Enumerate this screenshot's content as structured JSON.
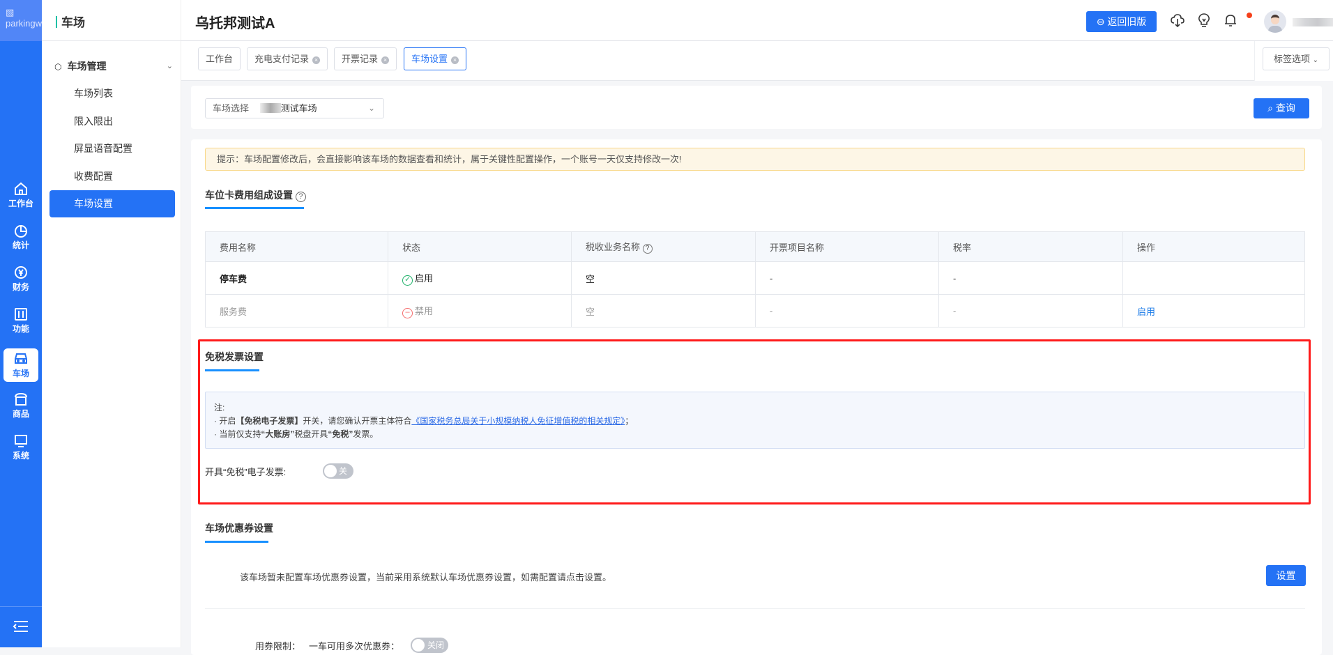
{
  "logo": {
    "alt": "parkingw"
  },
  "iconbar": {
    "items": [
      {
        "label": "工作台",
        "icon": "home-icon"
      },
      {
        "label": "统计",
        "icon": "pie-chart-icon"
      },
      {
        "label": "财务",
        "icon": "yen-icon"
      },
      {
        "label": "功能",
        "icon": "sliders-icon"
      },
      {
        "label": "车场",
        "icon": "car-icon",
        "active": true
      },
      {
        "label": "商品",
        "icon": "store-icon"
      },
      {
        "label": "系统",
        "icon": "monitor-icon"
      }
    ]
  },
  "sidebar": {
    "title": "车场",
    "group": "车场管理",
    "items": [
      "车场列表",
      "限入限出",
      "屏显语音配置",
      "收费配置",
      "车场设置"
    ],
    "active_index": 4
  },
  "header": {
    "title": "乌托邦测试A",
    "back_button": "返回旧版"
  },
  "tabs": {
    "items": [
      "工作台",
      "充电支付记录",
      "开票记录",
      "车场设置"
    ],
    "active_index": 3,
    "options_label": "标签选项"
  },
  "filter": {
    "label": "车场选择",
    "value": "测试车场",
    "query_button": "查询"
  },
  "alert": "提示：车场配置修改后，会直接影响该车场的数据查看和统计，属于关键性配置操作，一个账号一天仅支持修改一次!",
  "fee_section": {
    "title": "车位卡费用组成设置",
    "columns": [
      "费用名称",
      "状态",
      "税收业务名称",
      "开票项目名称",
      "税率",
      "操作"
    ],
    "rows": [
      {
        "name": "停车费",
        "status": "启用",
        "tax_name": "空",
        "item_name": "-",
        "rate": "-",
        "action": ""
      },
      {
        "name": "服务费",
        "status": "禁用",
        "tax_name": "空",
        "item_name": "-",
        "rate": "-",
        "action": "启用"
      }
    ]
  },
  "taxfree_section": {
    "title": "免税发票设置",
    "note_title": "注:",
    "note1_a": "· 开启",
    "note1_b": "【免税电子发票】",
    "note1_c": "开关，请您确认开票主体符合",
    "note1_link": "《国家税务总局关于小规模纳税人免征增值税的相关规定》",
    "note1_d": "；",
    "note2_a": "· 当前仅支持",
    "note2_b": "“大账房”",
    "note2_c": "税盘开具",
    "note2_d": "“免税”",
    "note2_e": "发票。",
    "toggle_label": "开具“免税”电子发票:",
    "toggle_text": "关",
    "toggle_on": false
  },
  "coupon_section": {
    "title": "车场优惠券设置",
    "desc": "该车场暂未配置车场优惠券设置，当前采用系统默认车场优惠券设置，如需配置请点击设置。",
    "set_button": "设置",
    "limit_label": "用券限制：",
    "multi_label": "一车可用多次优惠券：",
    "multi_toggle": "关闭"
  },
  "colors": {
    "primary": "#2472f5",
    "success": "#20b26b",
    "danger": "#f56c6c",
    "highlight": "#ff1a1a"
  }
}
